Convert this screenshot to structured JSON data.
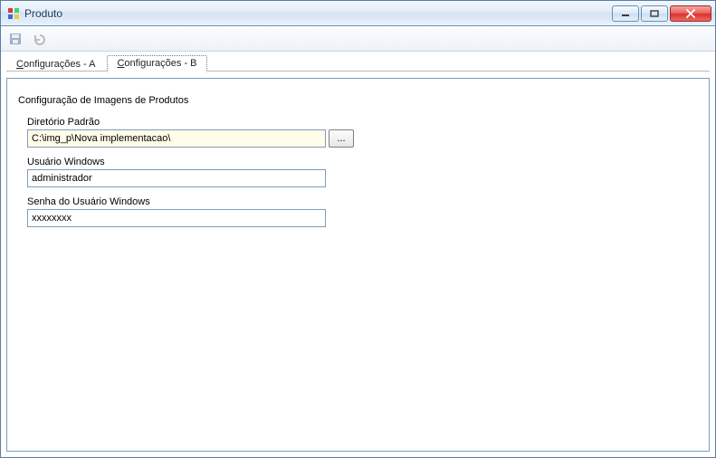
{
  "window": {
    "title": "Produto"
  },
  "tabs": {
    "a": {
      "hotkey": "C",
      "rest": "onfigurações - A"
    },
    "b": {
      "hotkey": "C",
      "rest": "onfigurações - B"
    }
  },
  "section": {
    "title": "Configuração de Imagens de Produtos"
  },
  "fields": {
    "dir": {
      "label": "Diretório Padrão",
      "value": "C:\\img_p\\Nova implementacao\\"
    },
    "user": {
      "label": "Usuário Windows",
      "value": "administrador"
    },
    "pass": {
      "label": "Senha do Usuário Windows",
      "value": "xxxxxxxx"
    }
  },
  "buttons": {
    "browse": "..."
  }
}
